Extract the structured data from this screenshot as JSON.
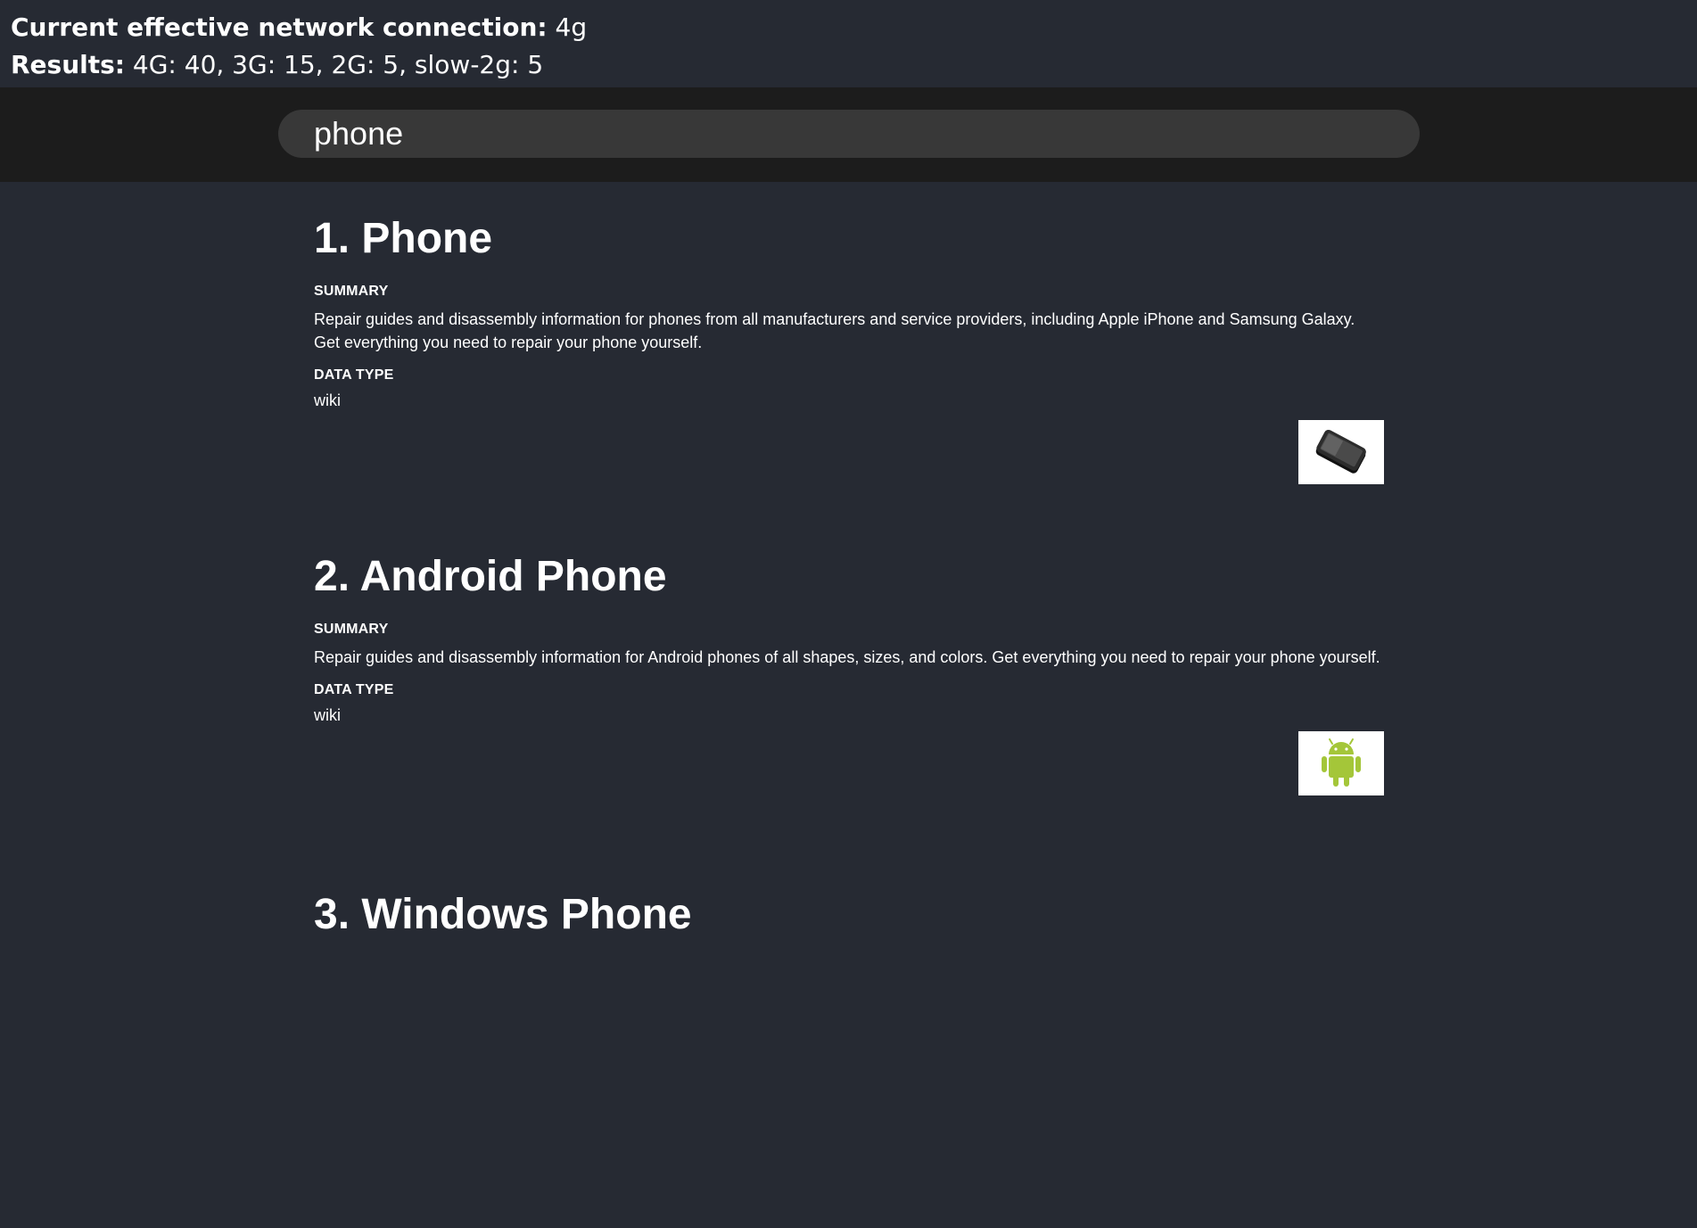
{
  "status": {
    "connection_label": "Current effective network connection:",
    "connection_value": "4g",
    "results_label": "Results:",
    "results_value": "4G: 40, 3G: 15, 2G: 5, slow-2g: 5"
  },
  "search": {
    "value": "phone"
  },
  "labels": {
    "summary": "SUMMARY",
    "data_type": "DATA TYPE"
  },
  "results": [
    {
      "title": "1. Phone",
      "summary": "Repair guides and disassembly information for phones from all manufacturers and service providers, including Apple iPhone and Samsung Galaxy. Get everything you need to repair your phone yourself.",
      "data_type": "wiki",
      "thumbnail_icon": "smartphone-icon"
    },
    {
      "title": "2. Android Phone",
      "summary": "Repair guides and disassembly information for Android phones of all shapes, sizes, and colors. Get everything you need to repair your phone yourself.",
      "data_type": "wiki",
      "thumbnail_icon": "android-robot-icon"
    },
    {
      "title": "3. Windows Phone"
    }
  ],
  "colors": {
    "page_background": "#262a33",
    "search_band": "#1c1c1c",
    "search_field": "#383838",
    "android_green": "#a4c639"
  }
}
